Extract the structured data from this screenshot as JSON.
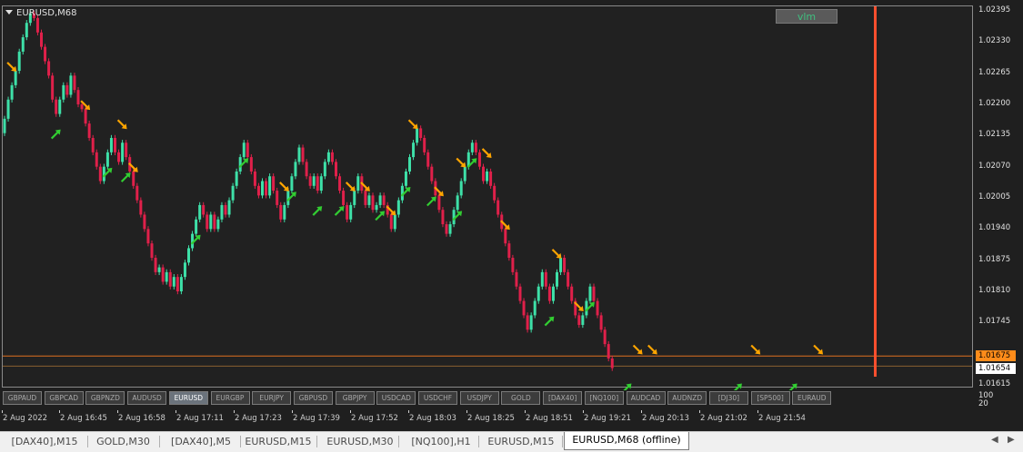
{
  "window": {
    "symbol_title": "EURUSD,M68",
    "indicator_button": "vlm"
  },
  "colors": {
    "background": "#212121",
    "bull_candle": "#3ee0a8",
    "bear_candle": "#e0204a",
    "up_arrow": "#32cd32",
    "down_arrow": "#ffa500",
    "vertical_line": "#ff4f2e",
    "price_line": "#e07020",
    "ask_line": "#8a6030"
  },
  "chart_data": {
    "type": "candlestick",
    "title": "EURUSD,M68",
    "y_ticks": [
      "1.02395",
      "1.02330",
      "1.02265",
      "1.02200",
      "1.02135",
      "1.02070",
      "1.02005",
      "1.01940",
      "1.01875",
      "1.01810",
      "1.01745",
      "1.01615"
    ],
    "ylim": [
      1.0158,
      1.0241
    ],
    "current_price": "1.01675",
    "second_price": "1.01654",
    "x_ticks": [
      "2 Aug 2022",
      "2 Aug 16:45",
      "2 Aug 16:58",
      "2 Aug 17:11",
      "2 Aug 17:23",
      "2 Aug 17:39",
      "2 Aug 17:52",
      "2 Aug 18:03",
      "2 Aug 18:25",
      "2 Aug 18:51",
      "2 Aug 19:21",
      "2 Aug 20:13",
      "2 Aug 21:02",
      "2 Aug 21:54"
    ],
    "closes": [
      1.0217,
      1.0221,
      1.0224,
      1.0227,
      1.0231,
      1.0234,
      1.0237,
      1.0239,
      1.0238,
      1.0235,
      1.0232,
      1.0229,
      1.0226,
      1.0221,
      1.0218,
      1.0221,
      1.0224,
      1.0222,
      1.0226,
      1.0223,
      1.022,
      1.0219,
      1.0216,
      1.0213,
      1.021,
      1.0207,
      1.0204,
      1.0207,
      1.021,
      1.0213,
      1.021,
      1.0208,
      1.0212,
      1.0209,
      1.0206,
      1.0203,
      1.02,
      1.0197,
      1.0194,
      1.0191,
      1.0188,
      1.0185,
      1.0186,
      1.0183,
      1.0185,
      1.0182,
      1.0184,
      1.0181,
      1.0184,
      1.0187,
      1.019,
      1.0193,
      1.0196,
      1.0199,
      1.0197,
      1.0194,
      1.0197,
      1.0194,
      1.0196,
      1.0199,
      1.0197,
      1.02,
      1.0203,
      1.0206,
      1.0209,
      1.0212,
      1.0209,
      1.0206,
      1.0203,
      1.0201,
      1.0204,
      1.0201,
      1.0205,
      1.0202,
      1.0199,
      1.0196,
      1.0199,
      1.0202,
      1.0205,
      1.0208,
      1.0211,
      1.0208,
      1.0205,
      1.0203,
      1.0205,
      1.0202,
      1.0205,
      1.0208,
      1.021,
      1.0208,
      1.0205,
      1.0202,
      1.0199,
      1.0196,
      1.0199,
      1.0202,
      1.0205,
      1.0202,
      1.0199,
      1.0201,
      1.0198,
      1.0199,
      1.0201,
      1.0199,
      1.0197,
      1.0194,
      1.0197,
      1.02,
      1.0203,
      1.0206,
      1.0209,
      1.0212,
      1.0215,
      1.0213,
      1.021,
      1.0207,
      1.0204,
      1.0201,
      1.0198,
      1.0195,
      1.0193,
      1.0195,
      1.0198,
      1.0201,
      1.0204,
      1.0207,
      1.021,
      1.0212,
      1.021,
      1.0207,
      1.0204,
      1.0206,
      1.0203,
      1.02,
      1.0197,
      1.0194,
      1.0191,
      1.0188,
      1.0185,
      1.0182,
      1.0179,
      1.0176,
      1.0173,
      1.0176,
      1.0179,
      1.0182,
      1.0185,
      1.0182,
      1.0179,
      1.0182,
      1.0185,
      1.0188,
      1.0185,
      1.0182,
      1.0179,
      1.0176,
      1.0174,
      1.0176,
      1.0179,
      1.0182,
      1.0179,
      1.0176,
      1.0173,
      1.017,
      1.0167,
      1.0165
    ]
  },
  "down_arrow_positions": [
    2,
    22,
    32,
    35,
    76,
    94,
    98,
    105,
    111,
    118,
    124,
    131,
    136,
    150,
    156,
    172,
    176,
    204,
    221
  ],
  "up_arrow_positions": [
    14,
    28,
    33,
    52,
    65,
    78,
    85,
    91,
    102,
    109,
    116,
    123,
    127,
    148,
    159,
    169,
    199,
    214
  ],
  "symbol_buttons": [
    {
      "label": "GBPAUD",
      "active": false
    },
    {
      "label": "GBPCAD",
      "active": false
    },
    {
      "label": "GBPNZD",
      "active": false
    },
    {
      "label": "AUDUSD",
      "active": false
    },
    {
      "label": "EURUSD",
      "active": true
    },
    {
      "label": "EURGBP",
      "active": false
    },
    {
      "label": "EURJPY",
      "active": false
    },
    {
      "label": "GBPUSD",
      "active": false
    },
    {
      "label": "GBPJPY",
      "active": false
    },
    {
      "label": "USDCAD",
      "active": false
    },
    {
      "label": "USDCHF",
      "active": false
    },
    {
      "label": "USDJPY",
      "active": false
    },
    {
      "label": "GOLD",
      "active": false
    },
    {
      "label": "[DAX40]",
      "active": false
    },
    {
      "label": "[NQ100]",
      "active": false
    },
    {
      "label": "AUDCAD",
      "active": false
    },
    {
      "label": "AUDNZD",
      "active": false
    },
    {
      "label": "[DJ30]",
      "active": false
    },
    {
      "label": "[SP500]",
      "active": false
    },
    {
      "label": "EURAUD",
      "active": false
    }
  ],
  "lower_axis": {
    "top": "100",
    "bottom": "20"
  },
  "tabs": [
    {
      "label": "[DAX40],M15",
      "active": false
    },
    {
      "label": "GOLD,M30",
      "active": false
    },
    {
      "label": "[DAX40],M5",
      "active": false
    },
    {
      "label": "EURUSD,M15",
      "active": false
    },
    {
      "label": "EURUSD,M30",
      "active": false
    },
    {
      "label": "[NQ100],H1",
      "active": false
    },
    {
      "label": "EURUSD,M15",
      "active": false
    },
    {
      "label": "EURUSD,M68 (offline)",
      "active": true
    }
  ],
  "tab_nav": {
    "left": "◀",
    "right": "▶"
  }
}
